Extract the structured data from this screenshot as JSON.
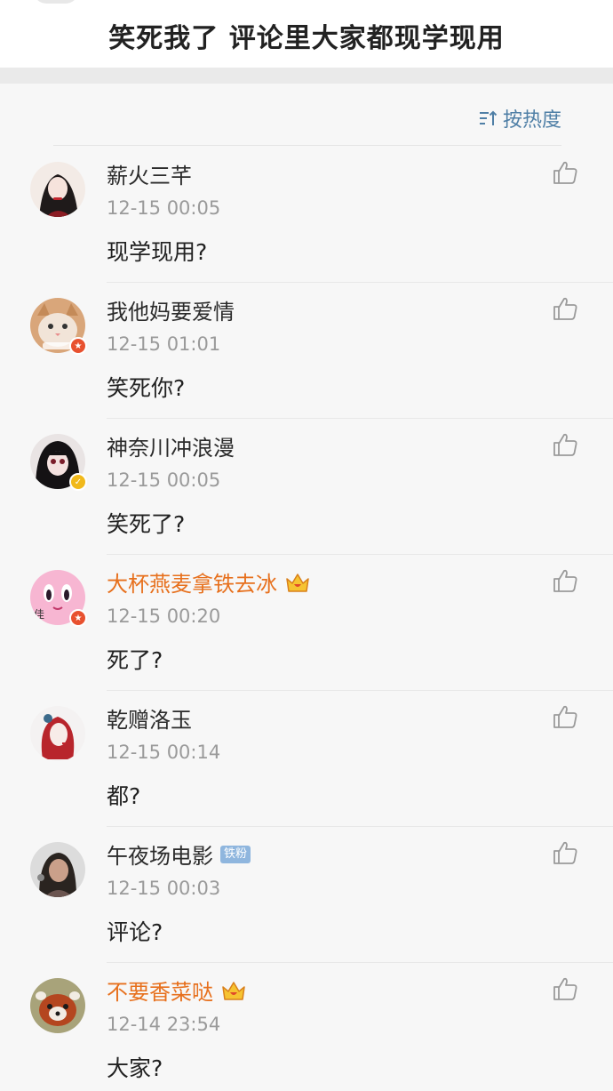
{
  "post": {
    "title": "笑死我了  评论里大家都现学现用"
  },
  "sort": {
    "label": "按热度",
    "icon": "sort-icon"
  },
  "colors": {
    "accent_link": "#4f7fa6",
    "vip_name": "#e7701d",
    "meta_gray": "#9a9a9a"
  },
  "comments": [
    {
      "user": "薪火三芊",
      "time": "12-15 00:05",
      "text": "现学现用?",
      "vip": false,
      "badge": "",
      "avatar": "avatar-woman-red-lips"
    },
    {
      "user": "我他妈要爱情",
      "time": "12-15 01:01",
      "text": "笑死你?",
      "vip": false,
      "badge": "",
      "avatar": "avatar-cat",
      "verified": "red"
    },
    {
      "user": "神奈川冲浪漫",
      "time": "12-15 00:05",
      "text": "笑死了?",
      "vip": false,
      "badge": "",
      "avatar": "avatar-dark-hair-girl",
      "verified": "gold"
    },
    {
      "user": "大杯燕麦拿铁去冰",
      "time": "12-15 00:20",
      "text": "死了?",
      "vip": true,
      "badge": "",
      "avatar": "avatar-pink-cartoon",
      "verified": "red"
    },
    {
      "user": "乾赠洛玉",
      "time": "12-15 00:14",
      "text": "都?",
      "vip": false,
      "badge": "",
      "avatar": "avatar-red-hair-drawing"
    },
    {
      "user": "午夜场电影",
      "time": "12-15 00:03",
      "text": "评论?",
      "vip": false,
      "badge": "铁粉",
      "avatar": "avatar-girl-photo"
    },
    {
      "user": "不要香菜哒",
      "time": "12-14 23:54",
      "text": "大家?",
      "vip": true,
      "badge": "",
      "avatar": "avatar-red-panda"
    }
  ]
}
